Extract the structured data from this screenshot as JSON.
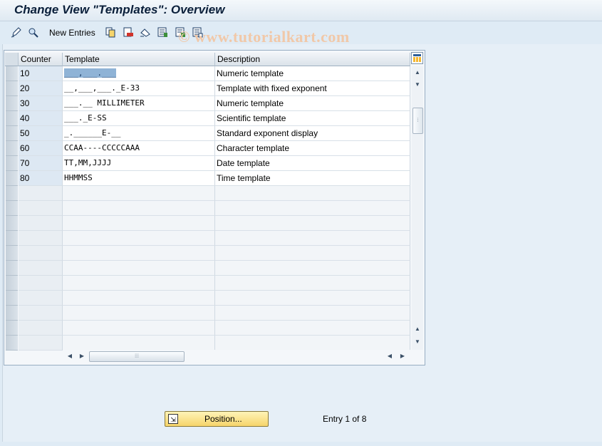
{
  "title": "Change View \"Templates\": Overview",
  "toolbar": {
    "new_entries_label": "New Entries",
    "icons": [
      "edit-pencil-icon",
      "display-glasses-icon",
      "copy-icon",
      "delete-icon",
      "undo-icon",
      "select-all-icon",
      "select-block-icon",
      "deselect-all-icon"
    ]
  },
  "watermark": "© www.tutorialkart.com",
  "table": {
    "columns": {
      "counter": "Counter",
      "template": "Template",
      "description": "Description"
    },
    "rows": [
      {
        "counter": "10",
        "template": "___,___.___",
        "description": "Numeric template"
      },
      {
        "counter": "20",
        "template": "__,___,___._E-33",
        "description": "Template with fixed exponent"
      },
      {
        "counter": "30",
        "template": "___.__ MILLIMETER",
        "description": "Numeric template"
      },
      {
        "counter": "40",
        "template": "___._E-SS",
        "description": "Scientific template"
      },
      {
        "counter": "50",
        "template": "_.______E-__",
        "description": "Standard exponent display"
      },
      {
        "counter": "60",
        "template": "CCAA----CCCCCAAA",
        "description": "Character template"
      },
      {
        "counter": "70",
        "template": "TT,MM,JJJJ",
        "description": "Date template"
      },
      {
        "counter": "80",
        "template": "HHMMSS",
        "description": "Time template"
      }
    ]
  },
  "footer": {
    "position_label": "Position...",
    "entry_text": "Entry 1 of 8"
  },
  "colors": {
    "button_yellow": "#f6d46a",
    "selection_blue": "#8fb3d6",
    "title_color": "#0a1f3a"
  }
}
